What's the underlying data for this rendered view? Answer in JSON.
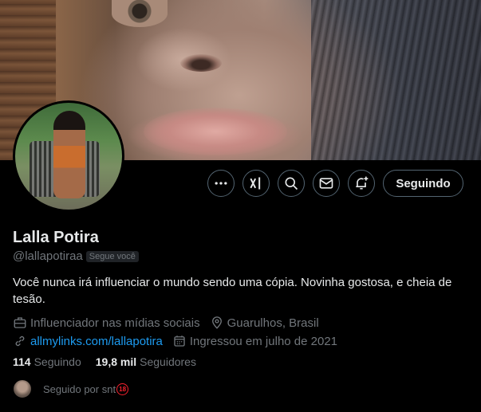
{
  "profile": {
    "name": "Lalla Potira",
    "handle": "@lallapotiraa",
    "follows_you_badge": "Segue você",
    "bio": "Você nunca irá influenciar o mundo sendo uma cópia. Novinha gostosa, e cheia de tesão.",
    "category": "Influenciador nas mídias sociais",
    "location": "Guarulhos, Brasil",
    "website": "allmylinks.com/lallapotira",
    "joined": "Ingressou em julho de 2021"
  },
  "stats": {
    "following_count": "114",
    "following_label": "Seguindo",
    "followers_count": "19,8 mil",
    "followers_label": "Seguidores"
  },
  "followed_by": {
    "text": "Seguido por snt",
    "badge": "18"
  },
  "actions": {
    "follow_label": "Seguindo",
    "icons": [
      "more-icon",
      "grok-icon",
      "search-icon",
      "message-icon",
      "notify-icon"
    ]
  },
  "colors": {
    "background": "#000000",
    "text_primary": "#e7e9ea",
    "text_secondary": "#71767b",
    "link": "#1d9bf0",
    "border": "#536471",
    "adult_badge": "#f4212e"
  }
}
